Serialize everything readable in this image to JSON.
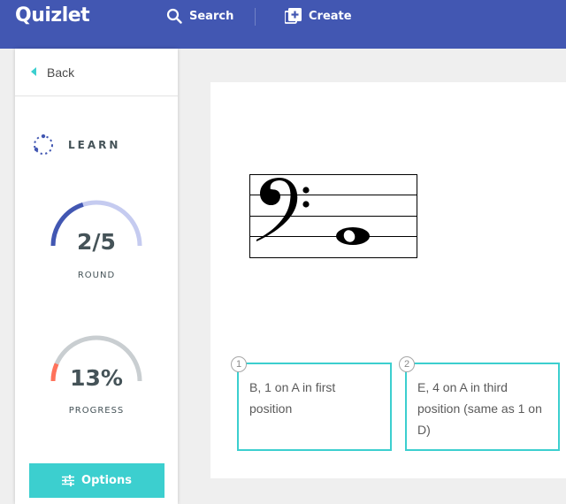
{
  "header": {
    "logo": "Quizlet",
    "search_label": "Search",
    "create_label": "Create",
    "icons": {
      "search": "search-icon",
      "create": "plus-box-icon"
    },
    "background": "#4257b2"
  },
  "sidebar": {
    "back_label": "Back",
    "mode_label": "LEARN",
    "round": {
      "value": "2/5",
      "label": "ROUND",
      "fraction": 0.4
    },
    "progress": {
      "value": "13%",
      "label": "PROGRESS",
      "percent": 13
    },
    "options_label": "Options"
  },
  "question": {
    "prompt_image": "bass-clef-staff-whole-note"
  },
  "answers": [
    {
      "number": "1",
      "text": "B, 1 on A in first position"
    },
    {
      "number": "2",
      "text": "E, 4 on A in third position (same as 1 on D)"
    }
  ],
  "colors": {
    "accent": "#3ccfcf",
    "round_fill": "#4257b2",
    "round_track": "#c5cbf0",
    "progress_fill": "#ff725b",
    "progress_track": "#c9ced1"
  }
}
